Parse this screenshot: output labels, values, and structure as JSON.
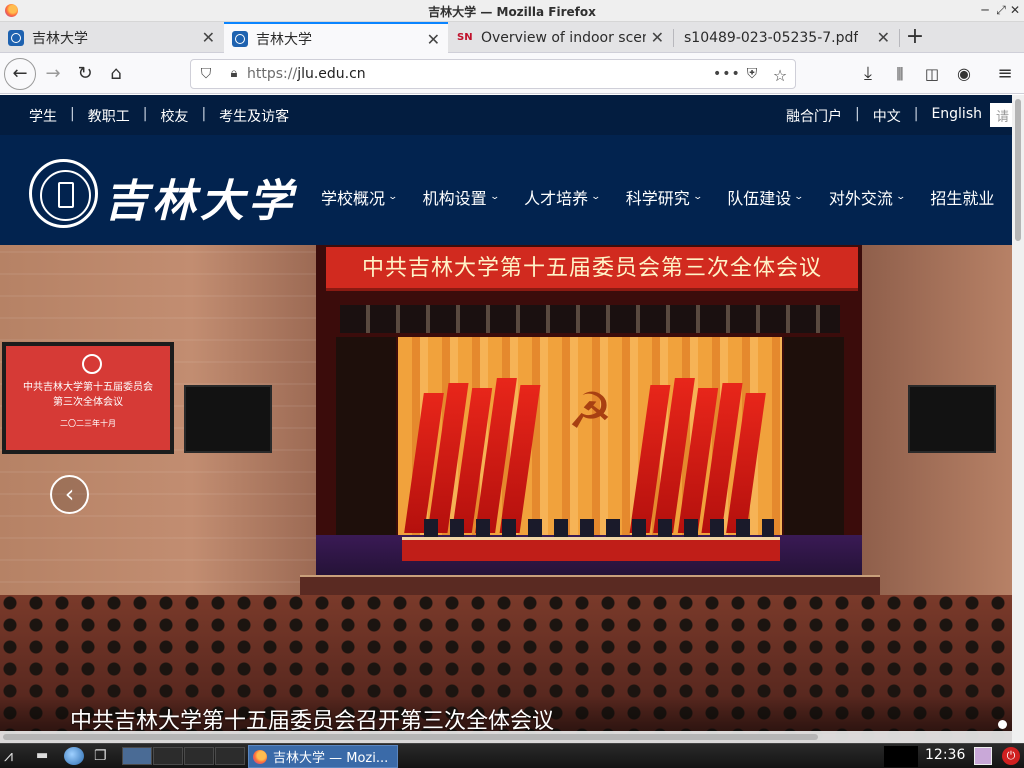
{
  "window": {
    "title": "吉林大学 — Mozilla Firefox"
  },
  "tabs": [
    {
      "label": "吉林大学",
      "active": false,
      "favicon": "jlu-favicon"
    },
    {
      "label": "吉林大学",
      "active": true,
      "favicon": "jlu-favicon"
    },
    {
      "label": "Overview of indoor scen",
      "active": false,
      "favicon": "SN"
    },
    {
      "label": "s10489-023-05235-7.pdf",
      "active": false,
      "favicon": "none"
    }
  ],
  "toolbar": {
    "url_scheme": "https://",
    "url_host": "jlu.edu.cn",
    "icons": [
      "back-icon",
      "forward-icon",
      "reload-icon",
      "home-icon",
      "shield-icon",
      "lock-icon",
      "more-dots-icon",
      "pocket-icon",
      "star-icon",
      "download-icon",
      "library-icon",
      "sidebar-icon",
      "account-icon",
      "menu-icon"
    ]
  },
  "site": {
    "top_links_left": [
      "学生",
      "教职工",
      "校友",
      "考生及访客"
    ],
    "top_links_right": [
      "融合门户",
      "中文",
      "English"
    ],
    "search_stub": "请",
    "logo_text": "吉林大学",
    "nav": [
      "学校概况",
      "机构设置",
      "人才培养",
      "科学研究",
      "队伍建设",
      "对外交流",
      "招生就业"
    ],
    "hero": {
      "banner": "中共吉林大学第十五届委员会第三次全体会议",
      "screen_title_line1": "中共吉林大学第十五届委员会",
      "screen_title_line2": "第三次全体会议",
      "screen_date": "二〇二三年十月",
      "caption": "中共吉林大学第十五届委员会召开第三次全体会议"
    }
  },
  "taskbar": {
    "task_label": "吉林大学 — Mozi...",
    "clock": "12:36"
  }
}
